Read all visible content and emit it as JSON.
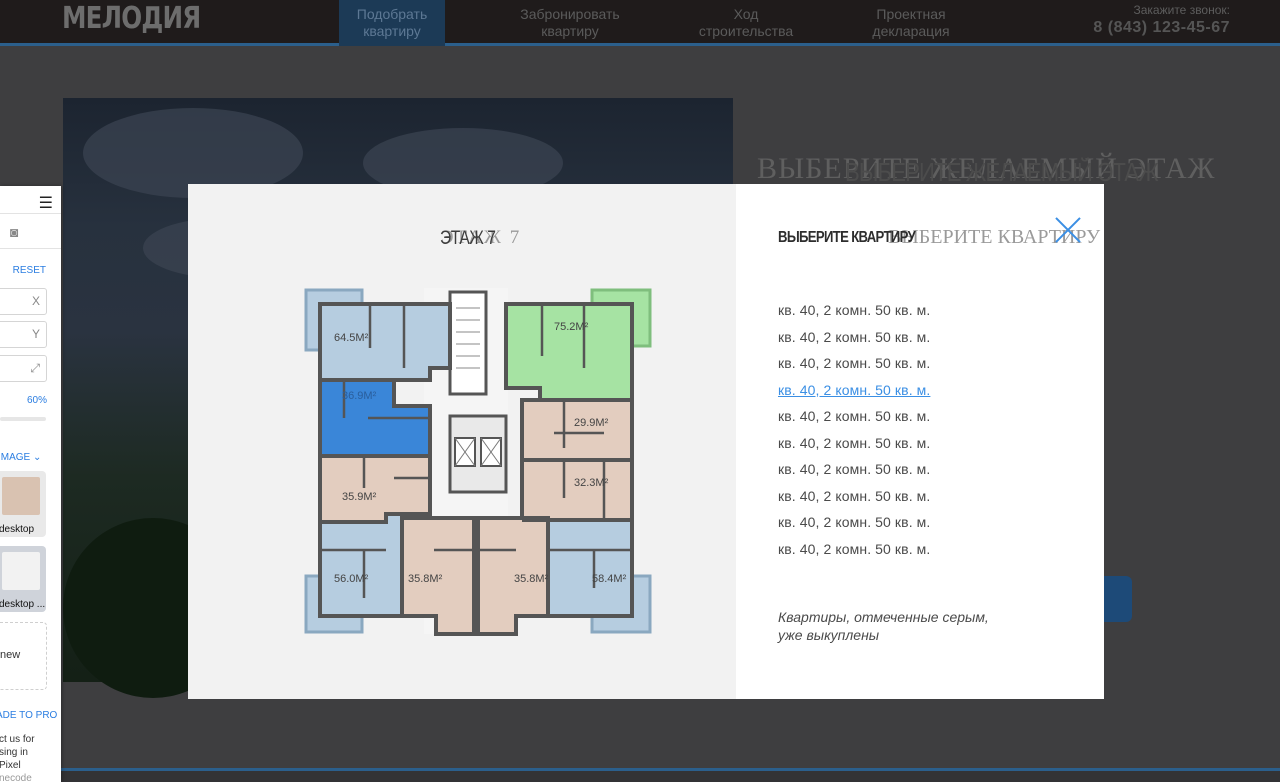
{
  "site": {
    "logo": "МЕЛОДИЯ",
    "nav": [
      {
        "line1": "Подобрать",
        "line2": "квартиру",
        "active": true
      },
      {
        "line1": "Забронировать",
        "line2": "квартиру",
        "active": false
      },
      {
        "line1": "Ход",
        "line2": "строительства",
        "active": false
      },
      {
        "line1": "Проектная",
        "line2": "декларация",
        "active": false
      }
    ],
    "phone_label": "Закажите звонок:",
    "phone": "8 (843) 123-45-67",
    "bg_title": "ВЫБЕРИТЕ ЖЕЛАЕМЫЙ ЭТАЖ"
  },
  "extension": {
    "reset": "RESET",
    "x_label": "X",
    "y_label": "Y",
    "opacity": "60%",
    "image_label": "IMAGE",
    "thumbs": [
      "desktop",
      "desktop ..."
    ],
    "new_label": "new",
    "upgrade": "ADE TO PRO",
    "contact": [
      "ct us for",
      "sing in",
      "Pixel",
      "necode"
    ]
  },
  "modal": {
    "floor_title": "ЭТАЖ 7",
    "right_title": "ВЫБЕРИТЕ КВАРТИРУ",
    "apartments": [
      "кв. 40, 2 комн. 50 кв. м.",
      "кв. 40, 2 комн. 50 кв. м.",
      "кв. 40, 2 комн. 50 кв. м.",
      "кв. 40, 2 комн. 50 кв. м.",
      "кв. 40, 2 комн. 50 кв. м.",
      "кв. 40, 2 комн. 50 кв. м.",
      "кв. 40, 2 комн. 50 кв. м.",
      "кв. 40, 2 комн. 50 кв. м.",
      "кв. 40, 2 комн. 50 кв. м.",
      "кв. 40, 2 комн. 50 кв. м."
    ],
    "selected_index": 3,
    "note_line1": "Квартиры, отмеченные серым,",
    "note_line2": "уже выкуплены",
    "plan_areas": [
      "64.5М²",
      "75.2М²",
      "36.9М²",
      "29.9М²",
      "32.3М²",
      "35.9М²",
      "56.0М²",
      "35.8М²",
      "35.8М²",
      "58.4М²"
    ],
    "colors": {
      "green": "#a6e3a3",
      "light_blue": "#b6cde0",
      "blue": "#3a86d8",
      "beige": "#e3cdbf",
      "accent": "#3b8fe4"
    }
  }
}
